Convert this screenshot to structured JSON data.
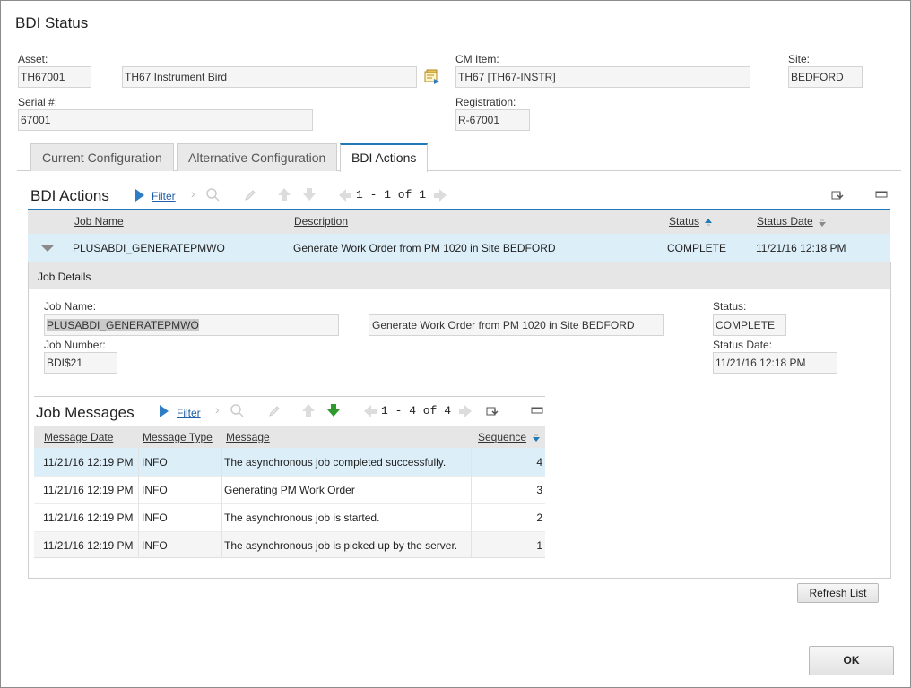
{
  "dialog": {
    "title": "BDI Status"
  },
  "header": {
    "asset_label": "Asset:",
    "asset_value": "TH67001",
    "asset_desc": "TH67 Instrument Bird",
    "cm_item_label": "CM Item:",
    "cm_item_value": "TH67 [TH67-INSTR]",
    "site_label": "Site:",
    "site_value": "BEDFORD",
    "serial_label": "Serial #:",
    "serial_value": "67001",
    "registration_label": "Registration:",
    "registration_value": "R-67001"
  },
  "tabs": [
    {
      "label": "Current Configuration"
    },
    {
      "label": "Alternative Configuration"
    },
    {
      "label": "BDI Actions"
    }
  ],
  "bdi_actions": {
    "title": "BDI Actions",
    "filter_label": "Filter",
    "pager": "1 - 1 of 1",
    "columns": {
      "job_name": "Job Name",
      "description": "Description",
      "status": "Status",
      "status_date": "Status Date"
    },
    "row": {
      "job_name": "PLUSABDI_GENERATEPMWO",
      "description": "Generate Work Order from PM 1020 in Site BEDFORD",
      "status": "COMPLETE",
      "status_date": "11/21/16 12:18 PM"
    }
  },
  "job_details": {
    "title": "Job Details",
    "job_name_label": "Job Name:",
    "job_name_value": "PLUSABDI_GENERATEPMWO",
    "description_value": "Generate Work Order from PM 1020 in Site BEDFORD",
    "job_number_label": "Job Number:",
    "job_number_value": "BDI$21",
    "status_label": "Status:",
    "status_value": "COMPLETE",
    "status_date_label": "Status Date:",
    "status_date_value": "11/21/16 12:18 PM"
  },
  "job_messages": {
    "title": "Job Messages",
    "filter_label": "Filter",
    "pager": "1 - 4 of 4",
    "columns": {
      "date": "Message Date",
      "type": "Message Type",
      "message": "Message",
      "sequence": "Sequence"
    },
    "rows": [
      {
        "date": "11/21/16 12:19 PM",
        "type": "INFO",
        "message": "The asynchronous job completed successfully.",
        "sequence": "4"
      },
      {
        "date": "11/21/16 12:19 PM",
        "type": "INFO",
        "message": "Generating PM Work Order",
        "sequence": "3"
      },
      {
        "date": "11/21/16 12:19 PM",
        "type": "INFO",
        "message": "The asynchronous job is started.",
        "sequence": "2"
      },
      {
        "date": "11/21/16 12:19 PM",
        "type": "INFO",
        "message": "The asynchronous job is picked up by the server.",
        "sequence": "1"
      }
    ]
  },
  "buttons": {
    "refresh": "Refresh List",
    "ok": "OK"
  },
  "colors": {
    "accent": "#1f7ab5",
    "row_highlight": "#dceef8",
    "arrow_green": "#2e9a2e"
  }
}
